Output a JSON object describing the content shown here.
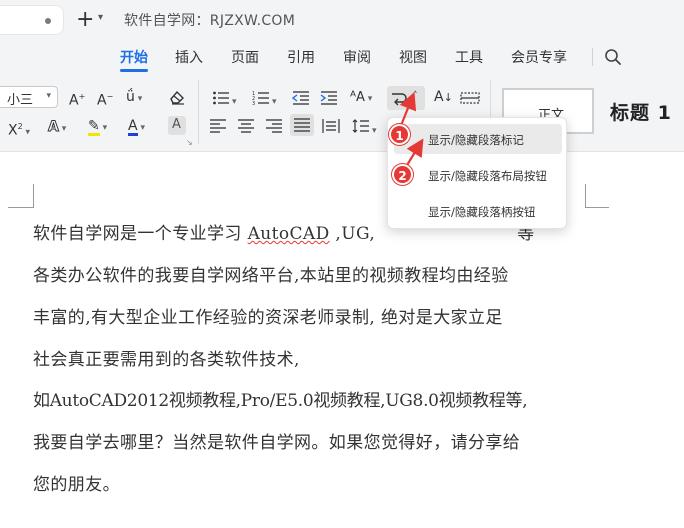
{
  "titlebar": {
    "new_tab_label": "+",
    "site_title": "软件自学网：RJZXW.COM"
  },
  "menu": {
    "items": [
      "开始",
      "插入",
      "页面",
      "引用",
      "审阅",
      "视图",
      "工具",
      "会员专享"
    ],
    "active": "开始"
  },
  "ribbon": {
    "font_size_value": "小三",
    "styles": {
      "normal": "正文",
      "heading1": "标题 1"
    },
    "accent_color": "#1f6fe5"
  },
  "popup": {
    "items": [
      "显示/隐藏段落标记",
      "显示/隐藏段落布局按钮",
      "显示/隐藏段落柄按钮"
    ]
  },
  "annotations": {
    "badge_1": "1",
    "badge_2": "2",
    "color": "#e53935"
  },
  "document": {
    "line1_a": "软件自学网是一个专业学习 ",
    "line1_b": "AutoCAD",
    "line1_c": " ,UG,",
    "line1_d": "等",
    "line2": "各类办公软件的我要自学网络平台,本站里的视频教程均由经验",
    "line3": "丰富的,有大型企业工作经验的资深老师录制, 绝对是大家立足",
    "line4": "社会真正要需用到的各类软件技术,",
    "line5": "如AutoCAD2012视频教程,Pro/E5.0视频教程,UG8.0视频教程等,",
    "line6": "我要自学去哪里？当然是软件自学网。如果您觉得好，请分享给",
    "line7": "您的朋友。"
  }
}
